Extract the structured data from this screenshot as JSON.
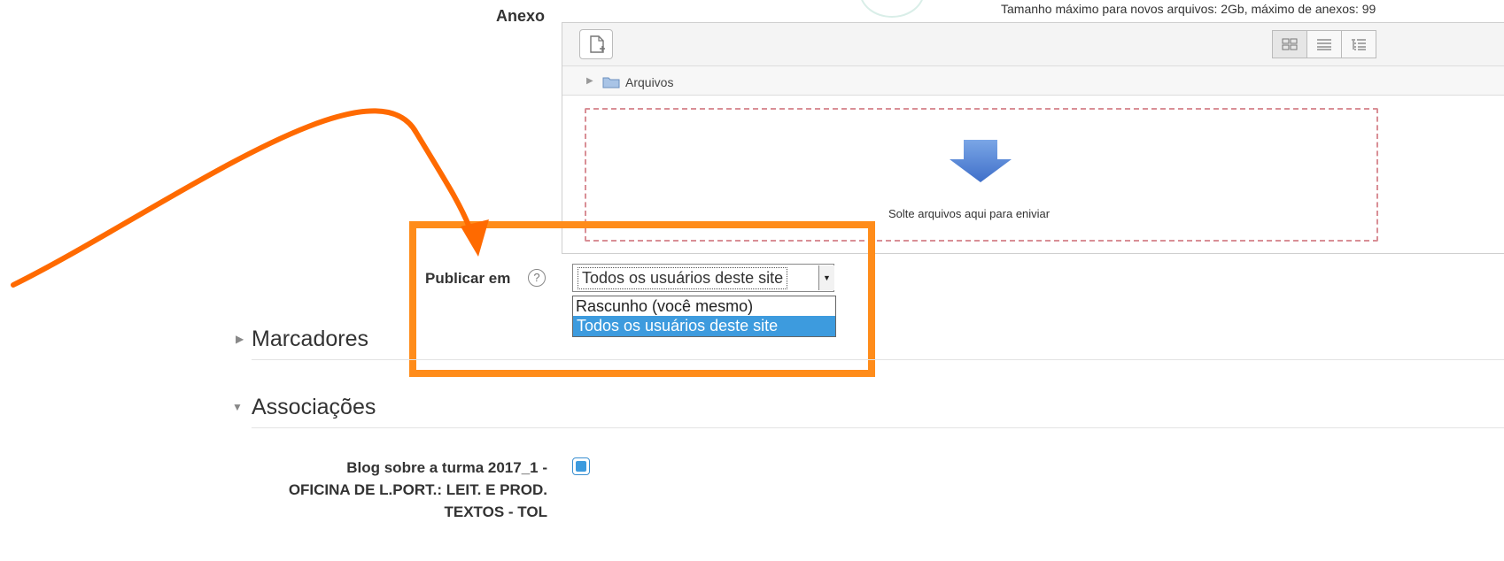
{
  "attachment": {
    "label": "Anexo",
    "max_info": "Tamanho máximo para novos arquivos: 2Gb, máximo de anexos: 99",
    "path_label": "Arquivos",
    "drop_text": "Solte arquivos aqui para eniviar"
  },
  "publish": {
    "label": "Publicar em",
    "help_icon": "?",
    "selected": "Todos os usuários deste site",
    "options": [
      "Rascunho (você mesmo)",
      "Todos os usuários deste site"
    ],
    "highlighted_option_index": 1
  },
  "sections": {
    "markers": {
      "title": "Marcadores",
      "expanded": false
    },
    "associations": {
      "title": "Associações",
      "expanded": true
    }
  },
  "association": {
    "blog_label_line1": "Blog sobre a turma 2017_1 -",
    "blog_label_line2": "OFICINA DE L.PORT.: LEIT. E PROD.",
    "blog_label_line3": "TEXTOS - TOL",
    "checked": true
  },
  "annotation": {
    "highlight_color": "#ff8c1a",
    "arrow_color": "#ff6a00"
  },
  "colors": {
    "selected_option": "#3d9bde",
    "dropzone_border": "#d98f96"
  }
}
